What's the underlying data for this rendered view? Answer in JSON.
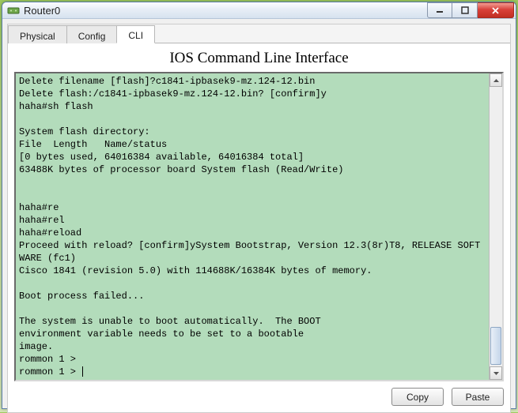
{
  "window": {
    "title": "Router0"
  },
  "tabs": {
    "physical": "Physical",
    "config": "Config",
    "cli": "CLI"
  },
  "cli": {
    "heading": "IOS Command Line Interface",
    "output": "Delete filename [flash]?c1841-ipbasek9-mz.124-12.bin\nDelete flash:/c1841-ipbasek9-mz.124-12.bin? [confirm]y\nhaha#sh flash\n\nSystem flash directory:\nFile  Length   Name/status\n[0 bytes used, 64016384 available, 64016384 total]\n63488K bytes of processor board System flash (Read/Write)\n\n\nhaha#re\nhaha#rel\nhaha#reload\nProceed with reload? [confirm]ySystem Bootstrap, Version 12.3(8r)T8, RELEASE SOFTWARE (fc1)\nCisco 1841 (revision 5.0) with 114688K/16384K bytes of memory.\n\nBoot process failed...\n\nThe system is unable to boot automatically.  The BOOT\nenvironment variable needs to be set to a bootable\nimage.\nrommon 1 >\nrommon 1 > "
  },
  "buttons": {
    "copy": "Copy",
    "paste": "Paste"
  }
}
